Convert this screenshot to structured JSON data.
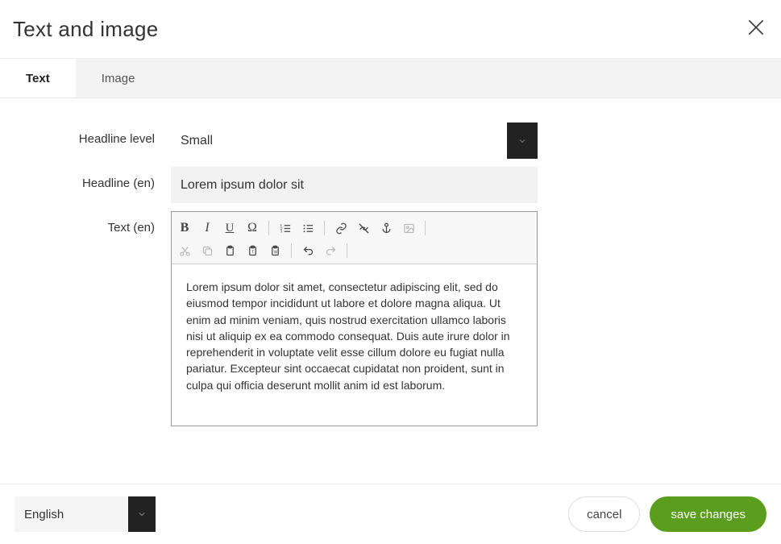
{
  "header": {
    "title": "Text and image"
  },
  "tabs": {
    "text": "Text",
    "image": "Image"
  },
  "form": {
    "headline_level": {
      "label": "Headline level",
      "value": "Small"
    },
    "headline": {
      "label": "Headline (en)",
      "value": "Lorem ipsum dolor sit"
    },
    "text": {
      "label": "Text (en)",
      "body": "Lorem ipsum dolor sit amet, consectetur adipiscing elit, sed do eiusmod tempor incididunt ut labore et dolore magna aliqua. Ut enim ad minim veniam, quis nostrud exercitation ullamco laboris nisi ut aliquip ex ea commodo consequat. Duis aute irure dolor in reprehenderit in voluptate velit esse cillum dolore eu fugiat nulla pariatur. Excepteur sint occaecat cupidatat non proident, sunt in culpa qui officia deserunt mollit anim id est laborum."
    }
  },
  "toolbar": {
    "bold": "B",
    "italic": "I",
    "underline": "U",
    "special_char": "Ω"
  },
  "footer": {
    "language": "English",
    "cancel": "cancel",
    "save": "save changes"
  }
}
